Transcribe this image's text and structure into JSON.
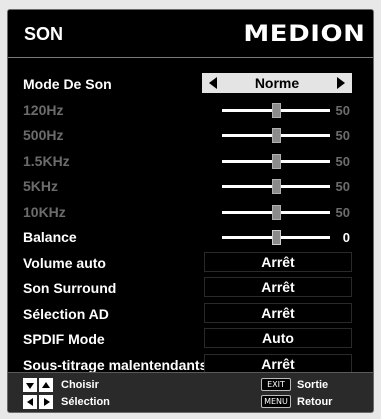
{
  "header": {
    "title": "SON",
    "logo": "MEDION"
  },
  "mode": {
    "label": "Mode De Son",
    "value": "Norme"
  },
  "eq": [
    {
      "label": "120Hz",
      "value": "50",
      "level": 0.5
    },
    {
      "label": "500Hz",
      "value": "50",
      "level": 0.5
    },
    {
      "label": "1.5KHz",
      "value": "50",
      "level": 0.5
    },
    {
      "label": "5KHz",
      "value": "50",
      "level": 0.5
    },
    {
      "label": "10KHz",
      "value": "50",
      "level": 0.5
    }
  ],
  "balance": {
    "label": "Balance",
    "value": "0",
    "level": 0.5
  },
  "options": [
    {
      "label": "Volume auto",
      "value": "Arrêt"
    },
    {
      "label": "Son Surround",
      "value": "Arrêt"
    },
    {
      "label": "Sélection AD",
      "value": "Arrêt"
    },
    {
      "label": "SPDIF Mode",
      "value": "Auto"
    },
    {
      "label": "Sous-titrage malentendants",
      "value": "Arrêt"
    }
  ],
  "footer": {
    "choose": "Choisir",
    "select": "Sélection",
    "exit_key": "EXIT",
    "exit": "Sortie",
    "menu_key": "MENU",
    "back": "Retour"
  },
  "icons": {
    "up": "triangle-up-icon",
    "down": "triangle-down-icon",
    "left": "triangle-left-icon",
    "right": "triangle-right-icon"
  }
}
